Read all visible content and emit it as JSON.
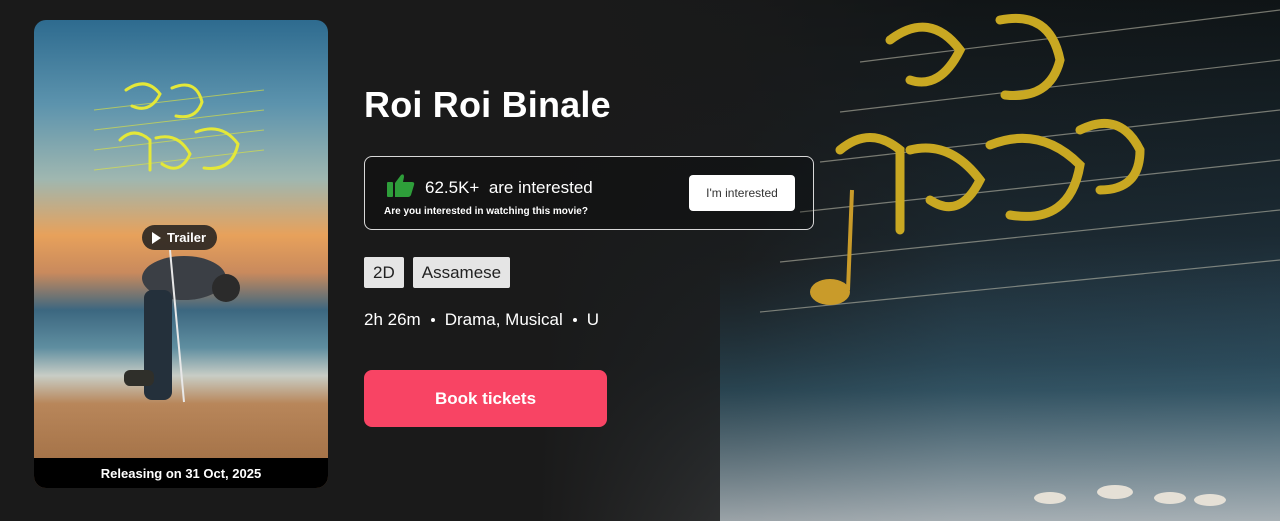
{
  "movie": {
    "title": "Roi Roi Binale",
    "release_text": "Releasing on 31 Oct, 2025",
    "trailer_label": "Trailer"
  },
  "interest": {
    "count_text": "62.5K+",
    "interested_suffix": "are interested",
    "question": "Are you interested in watching this movie?",
    "button_label": "I'm interested"
  },
  "tags": [
    "2D",
    "Assamese"
  ],
  "meta": {
    "duration": "2h 26m",
    "genres": "Drama, Musical",
    "rating": "U"
  },
  "cta": {
    "book_label": "Book tickets"
  },
  "colors": {
    "background": "#1a1a1a",
    "cta": "#f84464",
    "thumb": "#2e9e3a",
    "title_art": "#d4b62c"
  },
  "icons": [
    "play-icon",
    "thumbs-up-icon"
  ]
}
